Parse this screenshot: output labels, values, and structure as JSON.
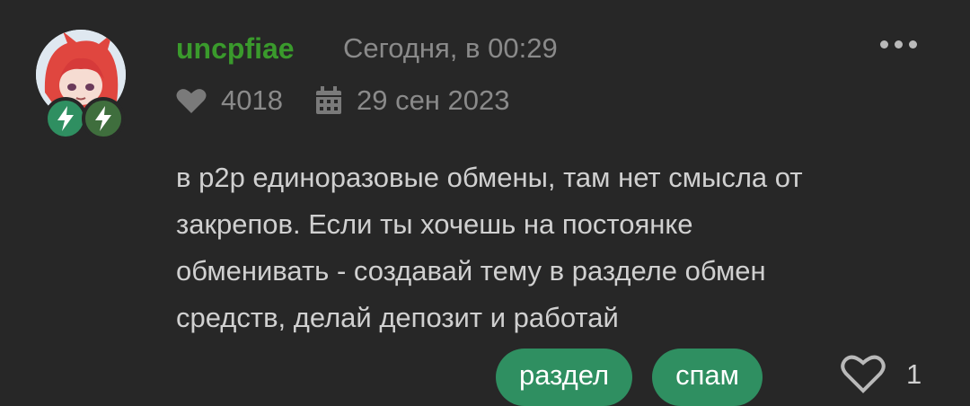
{
  "post": {
    "username": "uncpfiae",
    "timestamp": "Сегодня, в 00:29",
    "reactions": "4018",
    "registered": "29 сен 2023",
    "body_lines": [
      "в p2p единоразовые обмены, там нет смысла от",
      "закрепов. Если ты хочешь на постоянке",
      "обменивать - создавай тему в разделе обмен",
      "средств, делай депозит и работай"
    ],
    "tags": [
      "раздел",
      "спам"
    ],
    "likes": "1"
  },
  "icons": {
    "more": "more-dots-icon",
    "heart": "heart-icon",
    "calendar": "calendar-icon",
    "like": "heart-outline-icon",
    "badge": "lightning-icon"
  },
  "colors": {
    "background": "#272727",
    "username": "#3a9a2c",
    "tag_bg": "#2f8f61",
    "badge_1": "#2f8f61",
    "badge_2": "#3f6e3d"
  }
}
